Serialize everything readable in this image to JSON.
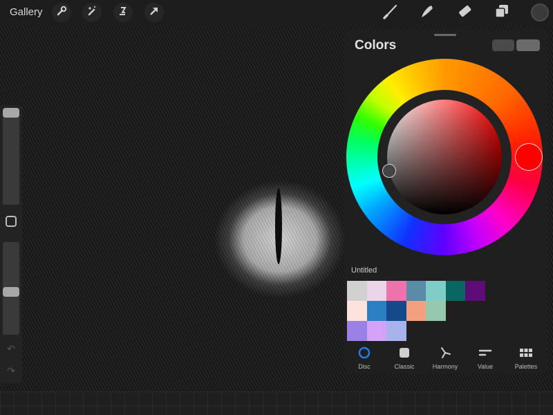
{
  "toolbar": {
    "gallery_label": "Gallery",
    "left_tools": [
      "wrench-icon",
      "magic-wand-icon",
      "selection-icon",
      "transform-arrow-icon"
    ],
    "right_tools": [
      "brush-icon",
      "smudge-icon",
      "eraser-icon",
      "layers-icon"
    ],
    "current_color": "#3a3a3a"
  },
  "sidebar": {
    "brush_size": 0.0,
    "brush_opacity": 0.5,
    "undo_label": "↶",
    "redo_label": "↷"
  },
  "colors_panel": {
    "title": "Colors",
    "selected_color": "#ff0000",
    "hue_degrees": 0,
    "palette_name": "Untitled",
    "palette": [
      [
        "#d2d1d1",
        "#ecd5e8",
        "#ef72ad",
        "#5a8ca8",
        "#7ecdc6",
        "#0a6660",
        "#5e0c78"
      ],
      [
        "#fde3dd",
        "#2c7fc0",
        "#144a8a",
        "#f3a080",
        "#96c8ae"
      ],
      [
        "#9b80e8",
        "#d4a2f8",
        "#a7b4ec"
      ]
    ],
    "tabs": [
      {
        "label": "Disc",
        "icon": "disc-icon",
        "active": true
      },
      {
        "label": "Classic",
        "icon": "classic-square-icon",
        "active": false
      },
      {
        "label": "Harmony",
        "icon": "harmony-icon",
        "active": false
      },
      {
        "label": "Value",
        "icon": "value-sliders-icon",
        "active": false
      },
      {
        "label": "Palettes",
        "icon": "palettes-grid-icon",
        "active": false
      }
    ]
  }
}
